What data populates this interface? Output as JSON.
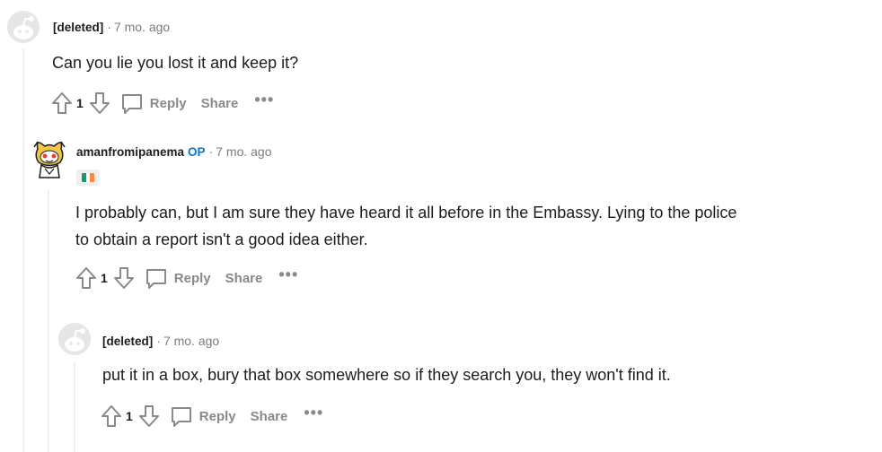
{
  "comments": [
    {
      "author": "[deleted]",
      "op_badge": "",
      "age": "7 mo. ago",
      "body": "Can you lie you lost it and keep it?",
      "score": "1",
      "reply_label": "Reply",
      "share_label": "Share",
      "more_label": "•••"
    },
    {
      "author": "amanfromipanema",
      "op_badge": "OP",
      "age": "7 mo. ago",
      "flair": "ireland-flag",
      "body": "I probably can, but I am sure they have heard it all before in the Embassy. Lying to the police\nto obtain a report isn't a good idea either.",
      "score": "1",
      "reply_label": "Reply",
      "share_label": "Share",
      "more_label": "•••"
    },
    {
      "author": "[deleted]",
      "op_badge": "",
      "age": "7 mo. ago",
      "body": "put it in a box, bury that box somewhere so if they search you, they won't find it.",
      "score": "1",
      "reply_label": "Reply",
      "share_label": "Share",
      "more_label": "•••"
    }
  ],
  "separator": "·",
  "colors": {
    "op": "#0079d3",
    "muted": "#878a8c",
    "thread_line": "#edeff1",
    "flag_green": "#169b62",
    "flag_white": "#ffffff",
    "flag_orange": "#ff883e"
  }
}
